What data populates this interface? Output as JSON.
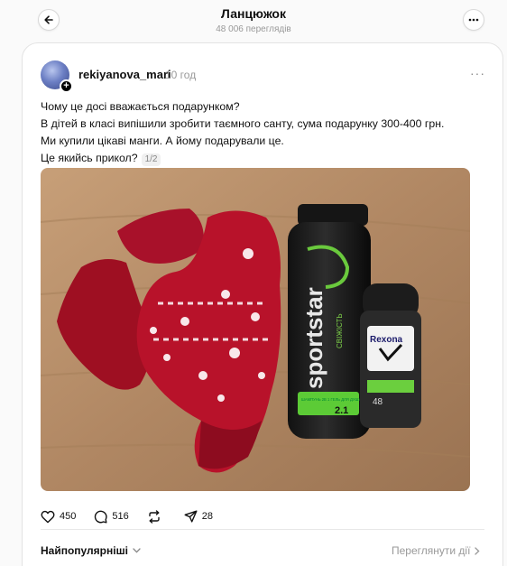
{
  "header": {
    "title": "Ланцюжок",
    "views": "48 006 переглядів",
    "back_icon": "arrow-left-icon",
    "more_icon": "more-horizontal-icon"
  },
  "post": {
    "username": "rekiyanova_mari",
    "time": "10 год",
    "lines": [
      "Чому це досі вважається подарунком?",
      "В дітей в класі випішили зробити таємного санту, сума подарунку 300-400 грн.",
      "Ми купили цікаві манги. А йому подарували це.",
      "Це якийсь прикол?"
    ],
    "image_counter": "1/2",
    "photo": {
      "bottle_brand": "sportstar",
      "bottle_sub": "СВІЖІСТЬ",
      "bottle_label": "ШАМПУНЬ 2В 1 ГЕЛЬ ДЛЯ ДУШУ",
      "bottle_badge": "2.1",
      "deo_brand": "Rexona",
      "deo_hours": "48"
    },
    "likes": "450",
    "comments": "516",
    "shares": "28",
    "icons": [
      "heart-icon",
      "comment-icon",
      "repost-icon",
      "send-icon"
    ]
  },
  "footer": {
    "sort_label": "Найпопулярніші",
    "activity_label": "Переглянути дії"
  },
  "colors": {
    "background": "#fafafa",
    "card": "#ffffff",
    "muted": "#999999",
    "sock_red": "#b8122a",
    "table_wood": "#b08763"
  }
}
